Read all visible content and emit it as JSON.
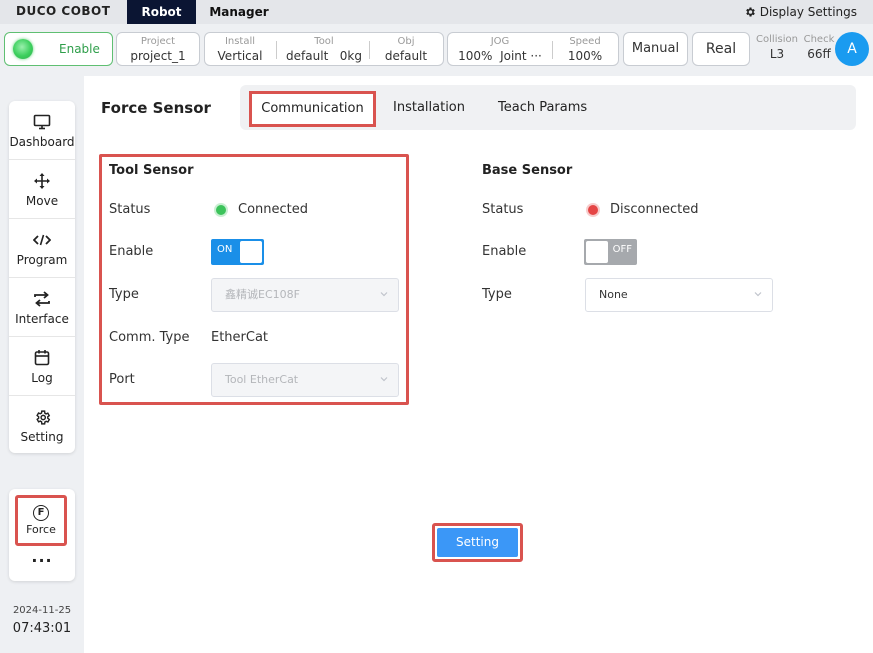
{
  "topbar": {
    "logo": "DUCO COBOT",
    "tabs": [
      "Robot",
      "Manager"
    ],
    "display_settings": "Display Settings"
  },
  "status": {
    "enable": "Enable",
    "project_label": "Project",
    "project_value": "project_1",
    "install_label": "Install",
    "install_value": "Vertical",
    "tool_label": "Tool",
    "tool_value": "default",
    "tool_weight": "0kg",
    "obj_label": "Obj",
    "obj_value": "default",
    "jog_label": "JOG",
    "jog_value": "100%",
    "jog_mode": "Joint ···",
    "speed_label": "Speed",
    "speed_value": "100%",
    "manual": "Manual",
    "real": "Real",
    "collision_label": "Collision",
    "collision_value": "L3",
    "check_label": "Check",
    "check_value": "66ff",
    "avatar": "A"
  },
  "sidebar": {
    "items": [
      {
        "label": "Dashboard",
        "icon": "monitor-icon"
      },
      {
        "label": "Move",
        "icon": "move-arrows-icon"
      },
      {
        "label": "Program",
        "icon": "code-icon"
      },
      {
        "label": "Interface",
        "icon": "swap-arrows-icon"
      },
      {
        "label": "Log",
        "icon": "calendar-icon"
      },
      {
        "label": "Setting",
        "icon": "gear-icon"
      }
    ],
    "force": {
      "label": "Force",
      "icon_letter": "F"
    },
    "more": "···",
    "date": "2024-11-25",
    "time": "07:43:01"
  },
  "main": {
    "title": "Force Sensor",
    "tabs": [
      {
        "label": "Communication",
        "active": true
      },
      {
        "label": "Installation",
        "active": false
      },
      {
        "label": "Teach Params",
        "active": false
      }
    ],
    "tool_sensor": {
      "title": "Tool Sensor",
      "status_label": "Status",
      "status_value": "Connected",
      "enable_label": "Enable",
      "enable_state": "ON",
      "type_label": "Type",
      "type_value": "鑫精诚EC108F",
      "comm_label": "Comm. Type",
      "comm_value": "EtherCat",
      "port_label": "Port",
      "port_value": "Tool EtherCat"
    },
    "base_sensor": {
      "title": "Base Sensor",
      "status_label": "Status",
      "status_value": "Disconnected",
      "enable_label": "Enable",
      "enable_state": "OFF",
      "type_label": "Type",
      "type_value": "None"
    },
    "setting_button": "Setting"
  },
  "colors": {
    "accent": "#1a8fe8",
    "highlight": "#d9534f",
    "connected": "#3cc35b",
    "disconnected": "#e54545",
    "nav_active": "#0b1533"
  }
}
